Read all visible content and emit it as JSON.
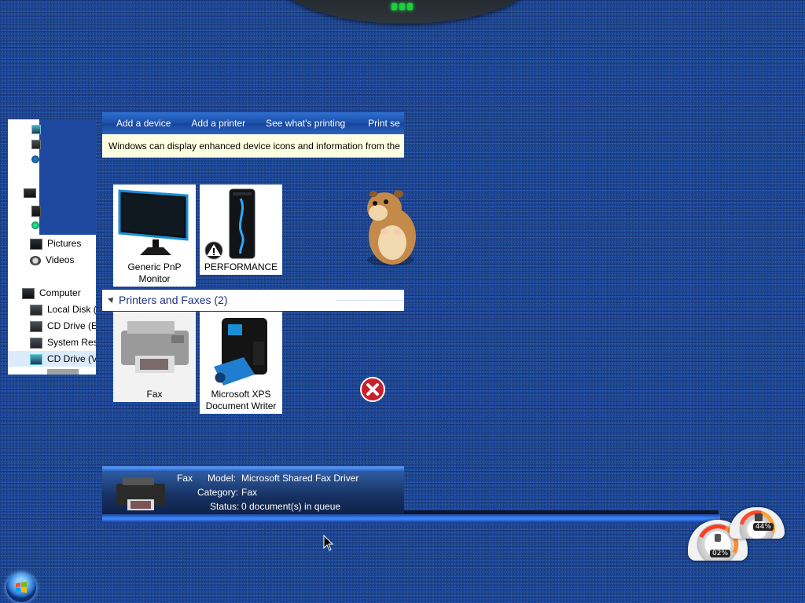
{
  "command_bar": {
    "items": [
      "Add a device",
      "Add a printer",
      "See what's printing",
      "Print se"
    ]
  },
  "info_bar": {
    "text": "Windows can display enhanced device icons and information from the"
  },
  "devices": [
    {
      "label_line1": "Generic PnP",
      "label_line2": "Monitor",
      "icon": "monitor-icon"
    },
    {
      "label_line1": "PERFORMANCE",
      "label_line2": "",
      "icon": "pc-tower-icon",
      "badge": "warning-icon"
    }
  ],
  "printers_group": {
    "header": "Printers and Faxes (2)",
    "items": [
      {
        "label_line1": "Fax",
        "label_line2": "",
        "icon": "fax-icon"
      },
      {
        "label_line1": "Microsoft XPS",
        "label_line2": "Document Writer",
        "icon": "xps-printer-icon"
      }
    ]
  },
  "details_pane": {
    "name": "Fax",
    "model_label": "Model:",
    "model_value": "Microsoft Shared Fax Driver",
    "category_label": "Category:",
    "category_value": "Fax",
    "status_label": "Status:",
    "status_value": "0 document(s) in queue"
  },
  "nav_pane": {
    "items": [
      "Pictures",
      "Videos",
      "Computer",
      "Local Disk (",
      "CD Drive (E:",
      "System Rese",
      "CD Drive (V:"
    ]
  },
  "gadgets": {
    "cpu_value": "02%",
    "ram_value": "44%"
  },
  "colors": {
    "desktop": "#1f49a0",
    "command_bar": "#1b4fa6",
    "info_bar": "#ffffe1",
    "group_header_text": "#1e3287"
  }
}
